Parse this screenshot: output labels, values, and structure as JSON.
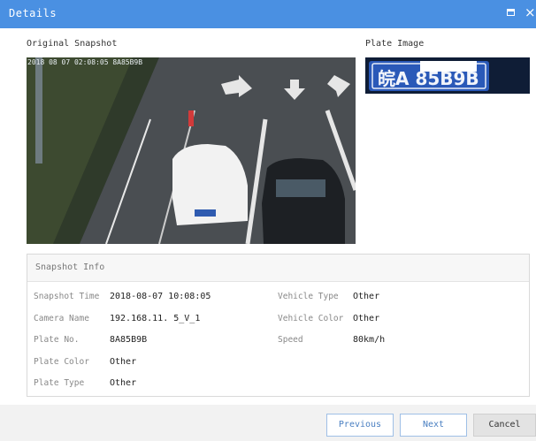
{
  "window": {
    "title": "Details",
    "maximize_icon": "maximize-icon",
    "close_icon": "close-icon",
    "close_glyph": "×"
  },
  "sections": {
    "original_snapshot": "Original Snapshot",
    "plate_image": "Plate Image"
  },
  "snapshot": {
    "timestamp_overlay": "2018 08 07 02:08:05 8A85B9B"
  },
  "plate_crop": {
    "visible_text": "皖A 85B9B"
  },
  "snapshot_info": {
    "title": "Snapshot Info",
    "left": [
      {
        "label": "Snapshot Time",
        "value": "2018-08-07 10:08:05"
      },
      {
        "label": "Camera Name",
        "value": "192.168.11. 5_V_1"
      },
      {
        "label": "Plate No.",
        "value": "8A85B9B"
      },
      {
        "label": "Plate Color",
        "value": "Other"
      },
      {
        "label": "Plate Type",
        "value": "Other"
      }
    ],
    "right": [
      {
        "label": "Vehicle Type",
        "value": "Other"
      },
      {
        "label": "Vehicle Color",
        "value": "Other"
      },
      {
        "label": "Speed",
        "value": "80km/h"
      }
    ]
  },
  "buttons": {
    "previous": "Previous",
    "next": "Next",
    "cancel": "Cancel"
  },
  "colors": {
    "title_bar": "#4a90e2",
    "button_text": "#4a7fc1",
    "footer": "#f2f2f2"
  }
}
